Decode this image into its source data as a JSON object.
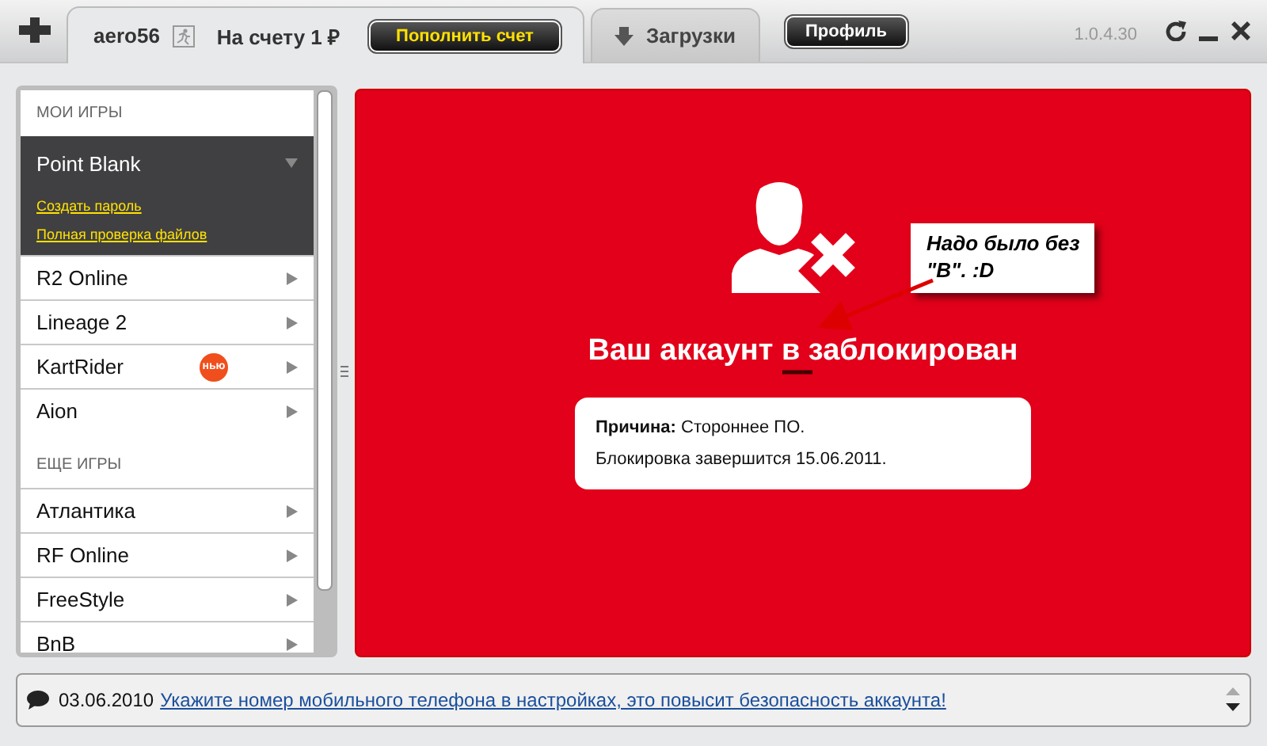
{
  "tabs": [
    {
      "kind": "account",
      "selected": true,
      "user": "aero56",
      "balance": "На счету 1 ₽",
      "action": "Пополнить счет"
    },
    {
      "kind": "downloads",
      "selected": false,
      "label": "Загрузки"
    }
  ],
  "profile_button": "Профиль",
  "version": "1.0.4.30",
  "sidebar": {
    "sections": [
      {
        "title": "МОИ ИГРЫ",
        "games": [
          {
            "name": "Point Blank",
            "expanded": true,
            "links": [
              "Создать пароль",
              "Полная проверка файлов"
            ]
          },
          {
            "name": "R2 Online",
            "expanded": false
          },
          {
            "name": "Lineage 2",
            "expanded": false
          },
          {
            "name": "KartRider",
            "expanded": false,
            "badge": "нью"
          },
          {
            "name": "Aion",
            "expanded": false
          }
        ]
      },
      {
        "title": "ЕЩЕ ИГРЫ",
        "games": [
          {
            "name": "Атлантика",
            "expanded": false
          },
          {
            "name": "RF Online",
            "expanded": false
          },
          {
            "name": "FreeStyle",
            "expanded": false
          },
          {
            "name": "BnB",
            "expanded": false
          }
        ]
      }
    ]
  },
  "panel": {
    "title": "Ваш аккаунт в заблокирован",
    "reason": "**Причина:** Стороннее ПО.",
    "until": "Блокировка завершится 15.06.2011.",
    "annotation": "Надо было без \"В\".  :D"
  },
  "notice": {
    "date": "03.06.2010",
    "link": "Укажите номер мобильного телефона в настройках, это повысит безопасность аккаунта!"
  }
}
